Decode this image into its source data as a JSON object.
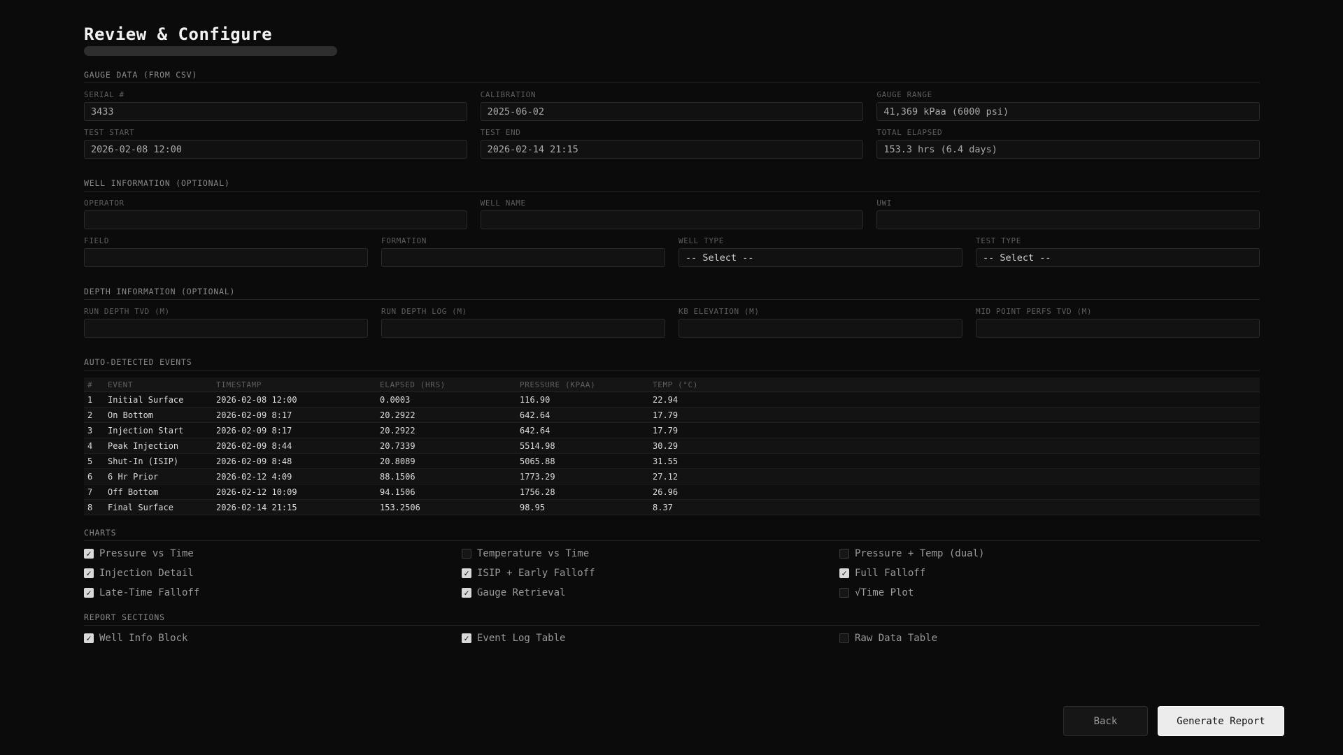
{
  "page": {
    "title": "Review & Configure"
  },
  "gauge": {
    "section_title": "GAUGE DATA (FROM CSV)",
    "fields": [
      {
        "label": "SERIAL #",
        "value": "3433"
      },
      {
        "label": "CALIBRATION",
        "value": "2025-06-02"
      },
      {
        "label": "GAUGE RANGE",
        "value": "41,369 kPaa (6000 psi)"
      },
      {
        "label": "TEST START",
        "value": "2026-02-08 12:00"
      },
      {
        "label": "TEST END",
        "value": "2026-02-14 21:15"
      },
      {
        "label": "TOTAL ELAPSED",
        "value": "153.3 hrs (6.4 days)"
      }
    ]
  },
  "well": {
    "section_title": "WELL INFORMATION (OPTIONAL)",
    "fields": [
      {
        "label": "OPERATOR",
        "value": ""
      },
      {
        "label": "WELL NAME",
        "value": ""
      },
      {
        "label": "UWI",
        "value": ""
      },
      {
        "label": "FIELD",
        "value": ""
      },
      {
        "label": "FORMATION",
        "value": ""
      },
      {
        "label": "WELL TYPE",
        "value": "-- Select --"
      },
      {
        "label": "TEST TYPE",
        "value": "-- Select --"
      }
    ]
  },
  "depth": {
    "section_title": "DEPTH INFORMATION (OPTIONAL)",
    "fields": [
      {
        "label": "RUN DEPTH TVD (M)",
        "value": ""
      },
      {
        "label": "RUN DEPTH LOG (M)",
        "value": ""
      },
      {
        "label": "KB ELEVATION (M)",
        "value": ""
      },
      {
        "label": "MID POINT PERFS TVD (M)",
        "value": ""
      }
    ]
  },
  "events": {
    "section_title": "AUTO-DETECTED EVENTS",
    "columns": [
      "#",
      "EVENT",
      "TIMESTAMP",
      "ELAPSED (HRS)",
      "PRESSURE (KPAA)",
      "TEMP (°C)"
    ],
    "rows": [
      [
        "1",
        "Initial Surface",
        "2026-02-08 12:00",
        "0.0003",
        "116.90",
        "22.94"
      ],
      [
        "2",
        "On Bottom",
        "2026-02-09 8:17",
        "20.2922",
        "642.64",
        "17.79"
      ],
      [
        "3",
        "Injection Start",
        "2026-02-09 8:17",
        "20.2922",
        "642.64",
        "17.79"
      ],
      [
        "4",
        "Peak Injection",
        "2026-02-09 8:44",
        "20.7339",
        "5514.98",
        "30.29"
      ],
      [
        "5",
        "Shut-In (ISIP)",
        "2026-02-09 8:48",
        "20.8089",
        "5065.88",
        "31.55"
      ],
      [
        "6",
        "6 Hr Prior",
        "2026-02-12 4:09",
        "88.1506",
        "1773.29",
        "27.12"
      ],
      [
        "7",
        "Off Bottom",
        "2026-02-12 10:09",
        "94.1506",
        "1756.28",
        "26.96"
      ],
      [
        "8",
        "Final Surface",
        "2026-02-14 21:15",
        "153.2506",
        "98.95",
        "8.37"
      ]
    ]
  },
  "charts": {
    "section_title": "CHARTS",
    "items": [
      {
        "label": "Pressure vs Time",
        "checked": true
      },
      {
        "label": "Temperature vs Time",
        "checked": false
      },
      {
        "label": "Pressure + Temp (dual)",
        "checked": false
      },
      {
        "label": "Injection Detail",
        "checked": true
      },
      {
        "label": "ISIP + Early Falloff",
        "checked": true
      },
      {
        "label": "Full Falloff",
        "checked": true
      },
      {
        "label": "Late-Time Falloff",
        "checked": true
      },
      {
        "label": "Gauge Retrieval",
        "checked": true
      },
      {
        "label": "√Time Plot",
        "checked": false
      }
    ]
  },
  "report": {
    "section_title": "REPORT SECTIONS",
    "items": [
      {
        "label": "Well Info Block",
        "checked": true
      },
      {
        "label": "Event Log Table",
        "checked": true
      },
      {
        "label": "Raw Data Table",
        "checked": false
      }
    ]
  },
  "buttons": {
    "back": "Back",
    "generate": "Generate Report"
  }
}
